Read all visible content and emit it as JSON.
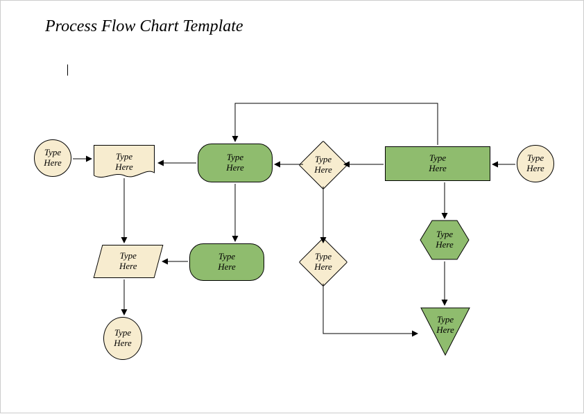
{
  "title": "Process Flow Chart Template",
  "nodes": {
    "circle1": "Type\nHere",
    "doc1": "Type\nHere",
    "capsule1": "Type\nHere",
    "diamond1": "Type\nHere",
    "rect1": "Type\nHere",
    "circle2": "Type\nHere",
    "para1": "Type\nHere",
    "capsule2": "Type\nHere",
    "diamond2": "Type\nHere",
    "hex1": "Type\nHere",
    "ellipse1": "Type\nHere",
    "tri1": "Type\nHere"
  },
  "colors": {
    "cream": "#f7eccf",
    "green": "#8fbc6e",
    "stroke": "#000000"
  }
}
